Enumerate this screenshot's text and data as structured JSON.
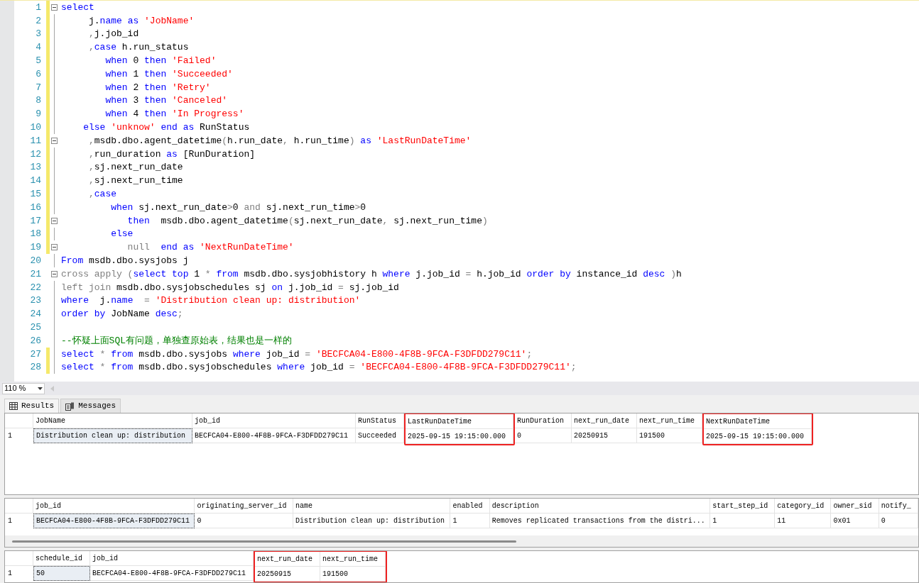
{
  "editor": {
    "lines": [
      {
        "number": "1",
        "modified": true,
        "fold": true,
        "tokens": [
          {
            "kind": "kw",
            "text": "select"
          }
        ]
      },
      {
        "number": "2",
        "modified": true,
        "fold": false,
        "tokens": [
          {
            "kind": "txt",
            "text": "     j."
          },
          {
            "kind": "kw",
            "text": "name"
          },
          {
            "kind": "kw",
            "text": " as "
          },
          {
            "kind": "str",
            "text": "'JobName'"
          }
        ]
      },
      {
        "number": "3",
        "modified": true,
        "fold": false,
        "tokens": [
          {
            "kind": "op",
            "text": "     ,"
          },
          {
            "kind": "txt",
            "text": "j.job_id"
          }
        ]
      },
      {
        "number": "4",
        "modified": true,
        "fold": false,
        "tokens": [
          {
            "kind": "op",
            "text": "     ,"
          },
          {
            "kind": "kw",
            "text": "case"
          },
          {
            "kind": "txt",
            "text": " h.run_status"
          }
        ]
      },
      {
        "number": "5",
        "modified": true,
        "fold": false,
        "tokens": [
          {
            "kind": "kw",
            "text": "        when"
          },
          {
            "kind": "txt",
            "text": " 0 "
          },
          {
            "kind": "kw",
            "text": "then "
          },
          {
            "kind": "str",
            "text": "'Failed'"
          }
        ]
      },
      {
        "number": "6",
        "modified": true,
        "fold": false,
        "tokens": [
          {
            "kind": "kw",
            "text": "        when"
          },
          {
            "kind": "txt",
            "text": " 1 "
          },
          {
            "kind": "kw",
            "text": "then "
          },
          {
            "kind": "str",
            "text": "'Succeeded'"
          }
        ]
      },
      {
        "number": "7",
        "modified": true,
        "fold": false,
        "tokens": [
          {
            "kind": "kw",
            "text": "        when"
          },
          {
            "kind": "txt",
            "text": " 2 "
          },
          {
            "kind": "kw",
            "text": "then "
          },
          {
            "kind": "str",
            "text": "'Retry'"
          }
        ]
      },
      {
        "number": "8",
        "modified": true,
        "fold": false,
        "tokens": [
          {
            "kind": "kw",
            "text": "        when"
          },
          {
            "kind": "txt",
            "text": " 3 "
          },
          {
            "kind": "kw",
            "text": "then "
          },
          {
            "kind": "str",
            "text": "'Canceled'"
          }
        ]
      },
      {
        "number": "9",
        "modified": true,
        "fold": false,
        "tokens": [
          {
            "kind": "kw",
            "text": "        when"
          },
          {
            "kind": "txt",
            "text": " 4 "
          },
          {
            "kind": "kw",
            "text": "then "
          },
          {
            "kind": "str",
            "text": "'In Progress'"
          }
        ]
      },
      {
        "number": "10",
        "modified": true,
        "fold": false,
        "tokens": [
          {
            "kind": "kw",
            "text": "    else "
          },
          {
            "kind": "str",
            "text": "'unknow'"
          },
          {
            "kind": "kw",
            "text": " end as"
          },
          {
            "kind": "txt",
            "text": " RunStatus"
          }
        ]
      },
      {
        "number": "11",
        "modified": true,
        "fold": true,
        "tokens": [
          {
            "kind": "op",
            "text": "     ,"
          },
          {
            "kind": "txt",
            "text": "msdb.dbo.agent_datetime"
          },
          {
            "kind": "op",
            "text": "("
          },
          {
            "kind": "txt",
            "text": "h.run_date"
          },
          {
            "kind": "op",
            "text": ","
          },
          {
            "kind": "txt",
            "text": " h.run_time"
          },
          {
            "kind": "op",
            "text": ")"
          },
          {
            "kind": "kw",
            "text": " as "
          },
          {
            "kind": "str",
            "text": "'LastRunDateTime'"
          }
        ]
      },
      {
        "number": "12",
        "modified": true,
        "fold": false,
        "tokens": [
          {
            "kind": "op",
            "text": "     ,"
          },
          {
            "kind": "txt",
            "text": "run_duration "
          },
          {
            "kind": "kw",
            "text": "as"
          },
          {
            "kind": "txt",
            "text": " [RunDuration]"
          }
        ]
      },
      {
        "number": "13",
        "modified": true,
        "fold": false,
        "tokens": [
          {
            "kind": "op",
            "text": "     ,"
          },
          {
            "kind": "txt",
            "text": "sj.next_run_date"
          }
        ]
      },
      {
        "number": "14",
        "modified": true,
        "fold": false,
        "tokens": [
          {
            "kind": "op",
            "text": "     ,"
          },
          {
            "kind": "txt",
            "text": "sj.next_run_time"
          }
        ]
      },
      {
        "number": "15",
        "modified": true,
        "fold": false,
        "tokens": [
          {
            "kind": "op",
            "text": "     ,"
          },
          {
            "kind": "kw",
            "text": "case"
          }
        ]
      },
      {
        "number": "16",
        "modified": true,
        "fold": false,
        "tokens": [
          {
            "kind": "kw",
            "text": "         when"
          },
          {
            "kind": "txt",
            "text": " sj.next_run_date"
          },
          {
            "kind": "op",
            "text": ">"
          },
          {
            "kind": "txt",
            "text": "0 "
          },
          {
            "kind": "op",
            "text": "and"
          },
          {
            "kind": "txt",
            "text": " sj.next_run_time"
          },
          {
            "kind": "op",
            "text": ">"
          },
          {
            "kind": "txt",
            "text": "0"
          }
        ]
      },
      {
        "number": "17",
        "modified": true,
        "fold": true,
        "tokens": [
          {
            "kind": "kw",
            "text": "            then"
          },
          {
            "kind": "txt",
            "text": "  msdb.dbo.agent_datetime"
          },
          {
            "kind": "op",
            "text": "("
          },
          {
            "kind": "txt",
            "text": "sj.next_run_date"
          },
          {
            "kind": "op",
            "text": ","
          },
          {
            "kind": "txt",
            "text": " sj.next_run_time"
          },
          {
            "kind": "op",
            "text": ")"
          }
        ]
      },
      {
        "number": "18",
        "modified": true,
        "fold": false,
        "tokens": [
          {
            "kind": "kw",
            "text": "         else"
          }
        ]
      },
      {
        "number": "19",
        "modified": true,
        "fold": true,
        "tokens": [
          {
            "kind": "op",
            "text": "            null"
          },
          {
            "kind": "kw",
            "text": "  end as "
          },
          {
            "kind": "str",
            "text": "'NextRunDateTime'"
          }
        ]
      },
      {
        "number": "20",
        "modified": false,
        "fold": false,
        "tokens": [
          {
            "kind": "kw",
            "text": "From"
          },
          {
            "kind": "txt",
            "text": " msdb.dbo.sysjobs j"
          }
        ]
      },
      {
        "number": "21",
        "modified": false,
        "fold": true,
        "tokens": [
          {
            "kind": "op",
            "text": "cross apply ("
          },
          {
            "kind": "kw",
            "text": "select top"
          },
          {
            "kind": "txt",
            "text": " 1 "
          },
          {
            "kind": "op",
            "text": "*"
          },
          {
            "kind": "kw",
            "text": " from"
          },
          {
            "kind": "txt",
            "text": " msdb.dbo.sysjobhistory h "
          },
          {
            "kind": "kw",
            "text": "where"
          },
          {
            "kind": "txt",
            "text": " j.job_id "
          },
          {
            "kind": "op",
            "text": "="
          },
          {
            "kind": "txt",
            "text": " h.job_id "
          },
          {
            "kind": "kw",
            "text": "order by"
          },
          {
            "kind": "txt",
            "text": " instance_id "
          },
          {
            "kind": "kw",
            "text": "desc"
          },
          {
            "kind": "op",
            "text": " )"
          },
          {
            "kind": "txt",
            "text": "h"
          }
        ]
      },
      {
        "number": "22",
        "modified": false,
        "fold": false,
        "tokens": [
          {
            "kind": "op",
            "text": "left join"
          },
          {
            "kind": "txt",
            "text": " msdb.dbo.sysjobschedules sj "
          },
          {
            "kind": "kw",
            "text": "on"
          },
          {
            "kind": "txt",
            "text": " j.job_id "
          },
          {
            "kind": "op",
            "text": "="
          },
          {
            "kind": "txt",
            "text": " sj.job_id"
          }
        ]
      },
      {
        "number": "23",
        "modified": false,
        "fold": false,
        "tokens": [
          {
            "kind": "kw",
            "text": "where"
          },
          {
            "kind": "txt",
            "text": "  j."
          },
          {
            "kind": "kw",
            "text": "name"
          },
          {
            "kind": "op",
            "text": "  = "
          },
          {
            "kind": "str",
            "text": "'Distribution clean up: distribution'"
          }
        ]
      },
      {
        "number": "24",
        "modified": false,
        "fold": false,
        "tokens": [
          {
            "kind": "kw",
            "text": "order by"
          },
          {
            "kind": "txt",
            "text": " JobName "
          },
          {
            "kind": "kw",
            "text": "desc"
          },
          {
            "kind": "op",
            "text": ";"
          }
        ]
      },
      {
        "number": "25",
        "modified": false,
        "fold": false
      },
      {
        "number": "26",
        "modified": false,
        "fold": false,
        "tokens": [
          {
            "kind": "comment",
            "text": "--怀疑上面SQL有问题，单独查原始表，结果也是一样的"
          }
        ]
      },
      {
        "number": "27",
        "modified": true,
        "fold": false,
        "tokens": [
          {
            "kind": "kw",
            "text": "select"
          },
          {
            "kind": "op",
            "text": " * "
          },
          {
            "kind": "kw",
            "text": "from"
          },
          {
            "kind": "txt",
            "text": " msdb.dbo.sysjobs "
          },
          {
            "kind": "kw",
            "text": "where"
          },
          {
            "kind": "txt",
            "text": " job_id "
          },
          {
            "kind": "op",
            "text": "= "
          },
          {
            "kind": "str",
            "text": "'BECFCA04-E800-4F8B-9FCA-F3DFDD279C11'"
          },
          {
            "kind": "op",
            "text": ";"
          }
        ]
      },
      {
        "number": "28",
        "modified": true,
        "fold": false,
        "tokens": [
          {
            "kind": "kw",
            "text": "select"
          },
          {
            "kind": "op",
            "text": " * "
          },
          {
            "kind": "kw",
            "text": "from"
          },
          {
            "kind": "txt",
            "text": " msdb.dbo.sysjobschedules "
          },
          {
            "kind": "kw",
            "text": "where"
          },
          {
            "kind": "txt",
            "text": " job_id "
          },
          {
            "kind": "op",
            "text": "= "
          },
          {
            "kind": "str",
            "text": "'BECFCA04-E800-4F8B-9FCA-F3DFDD279C11'"
          },
          {
            "kind": "op",
            "text": ";"
          }
        ]
      }
    ]
  },
  "zoom": {
    "value": "110 %"
  },
  "tabs": [
    {
      "label": "Results",
      "selected": true
    },
    {
      "label": "Messages",
      "selected": false
    }
  ],
  "grids": [
    {
      "scrollbar": false,
      "columns": [
        {
          "name": "JobName",
          "highlighted": false
        },
        {
          "name": "job_id",
          "highlighted": false
        },
        {
          "name": "RunStatus",
          "highlighted": false
        },
        {
          "name": "LastRunDateTime",
          "highlighted": true
        },
        {
          "name": "RunDuration",
          "highlighted": false
        },
        {
          "name": "next_run_date",
          "highlighted": false
        },
        {
          "name": "next_run_time",
          "highlighted": false
        },
        {
          "name": "NextRunDateTime",
          "highlighted": true
        }
      ],
      "rows": [
        {
          "number": "1",
          "cells": [
            {
              "text": "Distribution clean up: distribution",
              "selected": true
            },
            {
              "text": "BECFCA04-E800-4F8B-9FCA-F3DFDD279C11",
              "selected": false
            },
            {
              "text": "Succeeded",
              "selected": false
            },
            {
              "text": "2025-09-15 19:15:00.000",
              "selected": false
            },
            {
              "text": "0",
              "selected": false
            },
            {
              "text": "20250915",
              "selected": false
            },
            {
              "text": "191500",
              "selected": false
            },
            {
              "text": "2025-09-15 19:15:00.000",
              "selected": false
            }
          ]
        }
      ]
    },
    {
      "scrollbar": true,
      "columns": [
        {
          "name": "job_id",
          "highlighted": false
        },
        {
          "name": "originating_server_id",
          "highlighted": false
        },
        {
          "name": "name",
          "highlighted": false
        },
        {
          "name": "enabled",
          "highlighted": false
        },
        {
          "name": "description",
          "highlighted": false
        },
        {
          "name": "start_step_id",
          "highlighted": false
        },
        {
          "name": "category_id",
          "highlighted": false
        },
        {
          "name": "owner_sid",
          "highlighted": false
        },
        {
          "name": "notify_",
          "highlighted": false
        }
      ],
      "rows": [
        {
          "number": "1",
          "cells": [
            {
              "text": "BECFCA04-E800-4F8B-9FCA-F3DFDD279C11",
              "selected": true
            },
            {
              "text": "0",
              "selected": false
            },
            {
              "text": "Distribution clean up: distribution",
              "selected": false
            },
            {
              "text": "1",
              "selected": false
            },
            {
              "text": "Removes replicated transactions from the distri...",
              "selected": false
            },
            {
              "text": "1",
              "selected": false
            },
            {
              "text": "11",
              "selected": false
            },
            {
              "text": "0x01",
              "selected": false
            },
            {
              "text": "0",
              "selected": false
            }
          ]
        }
      ]
    },
    {
      "scrollbar": false,
      "columns": [
        {
          "name": "schedule_id",
          "highlighted": false
        },
        {
          "name": "job_id",
          "highlighted": false
        },
        {
          "name": "next_run_date",
          "highlighted": true
        },
        {
          "name": "next_run_time",
          "highlighted": true
        }
      ],
      "rows": [
        {
          "number": "1",
          "cells": [
            {
              "text": "50",
              "selected": true
            },
            {
              "text": "BECFCA04-E800-4F8B-9FCA-F3DFDD279C11",
              "selected": false
            },
            {
              "text": "20250915",
              "selected": false
            },
            {
              "text": "191500",
              "selected": false
            }
          ]
        }
      ]
    }
  ]
}
